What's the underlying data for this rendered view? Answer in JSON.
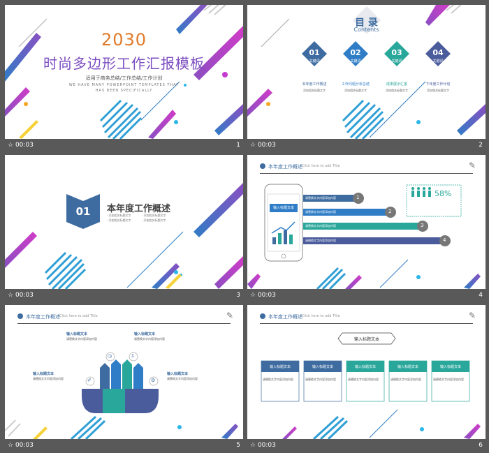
{
  "slides": [
    {
      "num": "1",
      "time": "00:03",
      "year": "2030",
      "title": "时尚多边形工作汇报模板",
      "subtitle": "适用于商务总结/工作总结/工作计划",
      "en1": "WE HAVE MANY POWERPOINT TEMPLATES THAT",
      "en2": "HAS BEEN SPECIFICALLY"
    },
    {
      "num": "2",
      "time": "00:03",
      "title": "目 录",
      "title_en": "Contents",
      "items": [
        {
          "n": "01",
          "kw": "关键词",
          "label": "本年度工作概述",
          "desc": "添加相关标题文字"
        },
        {
          "n": "02",
          "kw": "关键词",
          "label": "工作问题分析总结",
          "desc": "添加相关标题文字"
        },
        {
          "n": "03",
          "kw": "关键词",
          "label": "成果展示汇报",
          "desc": "添加相关标题文字"
        },
        {
          "n": "04",
          "kw": "关键词",
          "label": "下年度工作计划",
          "desc": "添加相关标题文字"
        }
      ]
    },
    {
      "num": "3",
      "time": "00:03",
      "badge": "01",
      "title": "本年度工作概述",
      "bullets": [
        "· 添加相关标题文字",
        "· 添加相关标题文字",
        "· 添加相关标题文字",
        "· 添加相关标题文字"
      ]
    },
    {
      "num": "4",
      "time": "00:03",
      "header": "本年度工作概述",
      "header_en": "Click here to add Title",
      "phone_label": "输入标题文本",
      "percent": "58%",
      "bars": [
        {
          "n": "1",
          "text": "请替换文字内容添加内容"
        },
        {
          "n": "2",
          "text": "请替换文字内容添加内容"
        },
        {
          "n": "3",
          "text": "请替换文字内容添加内容"
        },
        {
          "n": "4",
          "text": "请替换文字内容添加内容"
        }
      ]
    },
    {
      "num": "5",
      "time": "00:03",
      "header": "本年度工作概述",
      "header_en": "Click here to add Title",
      "labels": [
        {
          "title": "输入标题文本",
          "desc": "请替换文字内容添加内容"
        },
        {
          "title": "输入标题文本",
          "desc": "请替换文字内容添加内容"
        },
        {
          "title": "输入标题文本",
          "desc": "请替换文字内容添加内容"
        },
        {
          "title": "输入标题文本",
          "desc": "请替换文字内容添加内容"
        }
      ]
    },
    {
      "num": "6",
      "time": "00:03",
      "header": "本年度工作概述",
      "header_en": "Click here to add Title",
      "center_title": "输入标题文本",
      "cards": [
        {
          "title": "输入标题文本",
          "desc": "请替换文字内容添加内容"
        },
        {
          "title": "输入标题文本",
          "desc": "请替换文字内容添加内容"
        },
        {
          "title": "输入标题文本",
          "desc": "请替换文字内容添加内容"
        },
        {
          "title": "输入标题文本",
          "desc": "请替换文字内容添加内容"
        },
        {
          "title": "输入标题文本",
          "desc": "请替换文字内容添加内容"
        }
      ]
    }
  ],
  "colors": {
    "navy": "#3e6ca0",
    "blue": "#2f7dc6",
    "teal": "#2aa79b",
    "purple": "#8a4fc2",
    "pink": "#d13bc7"
  }
}
